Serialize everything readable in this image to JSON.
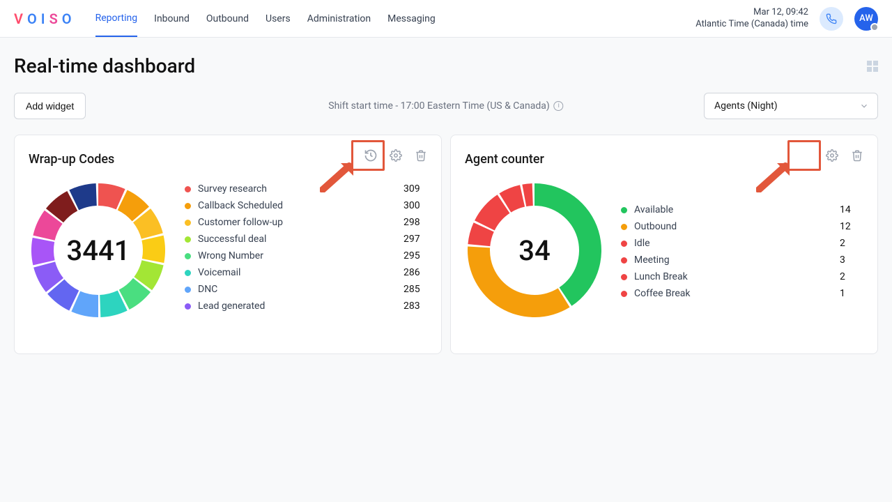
{
  "header": {
    "logo_letters": [
      "V",
      "O",
      "I",
      "S",
      "O"
    ],
    "nav": [
      "Reporting",
      "Inbound",
      "Outbound",
      "Users",
      "Administration",
      "Messaging"
    ],
    "active_nav": "Reporting",
    "datetime_line1": "Mar 12, 09:42",
    "datetime_line2": "Atlantic Time (Canada) time",
    "avatar_initials": "AW"
  },
  "page": {
    "title": "Real-time dashboard",
    "add_widget_label": "Add widget",
    "shift_text": "Shift start time - 17:00 Eastern Time (US & Canada)",
    "select_value": "Agents (Night)"
  },
  "widgets": {
    "wrapup": {
      "title": "Wrap-up Codes",
      "total": "3441",
      "items": [
        {
          "label": "Survey research",
          "value": "309",
          "color": "#ef5350"
        },
        {
          "label": "Callback Scheduled",
          "value": "300",
          "color": "#f59e0b"
        },
        {
          "label": "Customer follow-up",
          "value": "298",
          "color": "#fbbf24"
        },
        {
          "label": "Successful deal",
          "value": "297",
          "color": "#a3e635"
        },
        {
          "label": "Wrong Number",
          "value": "295",
          "color": "#4ade80"
        },
        {
          "label": "Voicemail",
          "value": "286",
          "color": "#2dd4bf"
        },
        {
          "label": "DNC",
          "value": "285",
          "color": "#60a5fa"
        },
        {
          "label": "Lead generated",
          "value": "283",
          "color": "#8b5cf6"
        }
      ]
    },
    "agent": {
      "title": "Agent counter",
      "total": "34",
      "items": [
        {
          "label": "Available",
          "value": "14",
          "color": "#22c55e"
        },
        {
          "label": "Outbound",
          "value": "12",
          "color": "#f59e0b"
        },
        {
          "label": "Idle",
          "value": "2",
          "color": "#ef4444"
        },
        {
          "label": "Meeting",
          "value": "3",
          "color": "#ef4444"
        },
        {
          "label": "Lunch Break",
          "value": "2",
          "color": "#ef4444"
        },
        {
          "label": "Coffee Break",
          "value": "1",
          "color": "#ef4444"
        }
      ]
    }
  },
  "chart_data": [
    {
      "type": "pie",
      "title": "Wrap-up Codes",
      "total": 3441,
      "series": [
        {
          "name": "Survey research",
          "value": 309,
          "color": "#ef5350"
        },
        {
          "name": "Callback Scheduled",
          "value": 300,
          "color": "#f59e0b"
        },
        {
          "name": "Customer follow-up",
          "value": 298,
          "color": "#fbbf24"
        },
        {
          "name": "Successful deal",
          "value": 297,
          "color": "#a3e635"
        },
        {
          "name": "Wrong Number",
          "value": 295,
          "color": "#4ade80"
        },
        {
          "name": "Voicemail",
          "value": 286,
          "color": "#2dd4bf"
        },
        {
          "name": "DNC",
          "value": 285,
          "color": "#60a5fa"
        },
        {
          "name": "Lead generated",
          "value": 283,
          "color": "#8b5cf6"
        }
      ]
    },
    {
      "type": "pie",
      "title": "Agent counter",
      "total": 34,
      "series": [
        {
          "name": "Available",
          "value": 14,
          "color": "#22c55e"
        },
        {
          "name": "Outbound",
          "value": 12,
          "color": "#f59e0b"
        },
        {
          "name": "Idle",
          "value": 2,
          "color": "#ef4444"
        },
        {
          "name": "Meeting",
          "value": 3,
          "color": "#ef4444"
        },
        {
          "name": "Lunch Break",
          "value": 2,
          "color": "#ef4444"
        },
        {
          "name": "Coffee Break",
          "value": 1,
          "color": "#ef4444"
        }
      ]
    }
  ]
}
